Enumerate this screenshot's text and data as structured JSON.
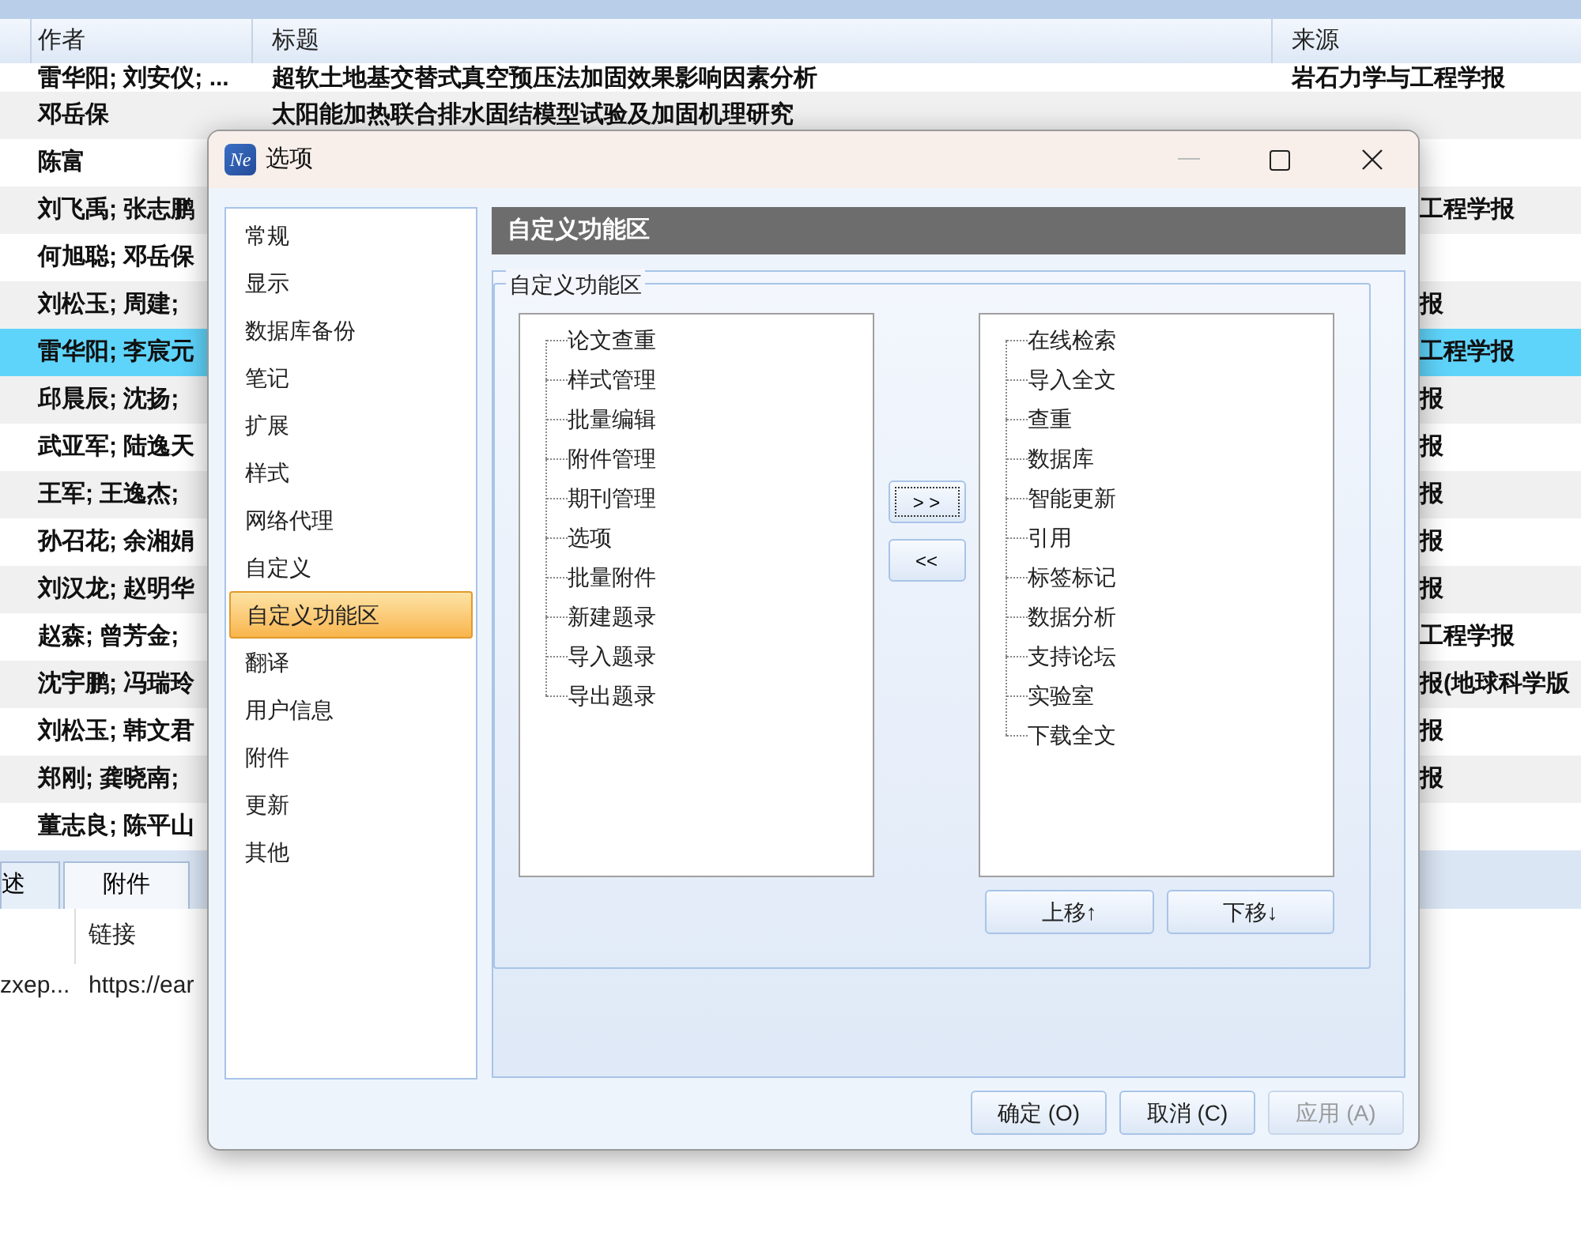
{
  "table": {
    "columns": [
      "作者",
      "标题",
      "来源"
    ],
    "rows": [
      {
        "author": "雷华阳; 刘安仪; ...",
        "title": "超软土地基交替式真空预压法加固效果影响因素分析",
        "source": "岩石力学与工程学报",
        "selected": false
      },
      {
        "author": "邓岳保",
        "title": "太阳能加热联合排水固结模型试验及加固机理研究",
        "selected": false
      },
      {
        "author": "陈富",
        "selected": false
      },
      {
        "author": "刘飞禹; 张志鹏",
        "source": "工程学报",
        "selected": false
      },
      {
        "author": "何旭聪; 邓岳保",
        "selected": false
      },
      {
        "author": "刘松玉; 周建;",
        "source": "报",
        "selected": false
      },
      {
        "author": "雷华阳; 李宸元",
        "source": "工程学报",
        "selected": true
      },
      {
        "author": "邱晨辰; 沈扬;",
        "source": "报",
        "selected": false
      },
      {
        "author": "武亚军; 陆逸天",
        "source": "报",
        "selected": false
      },
      {
        "author": "王军; 王逸杰;",
        "source": "报",
        "selected": false
      },
      {
        "author": "孙召花; 余湘娟",
        "source": "报",
        "selected": false
      },
      {
        "author": "刘汉龙; 赵明华",
        "source": "报",
        "selected": false
      },
      {
        "author": "赵森; 曾芳金;",
        "source": "工程学报",
        "selected": false
      },
      {
        "author": "沈宇鹏; 冯瑞玲",
        "source": "报(地球科学版",
        "selected": false
      },
      {
        "author": "刘松玉; 韩文君",
        "source": "报",
        "selected": false
      },
      {
        "author": "郑刚; 龚晓南;",
        "source": "报",
        "selected": false
      },
      {
        "author": "董志良; 陈平山",
        "selected": false
      }
    ]
  },
  "bottom_panel": {
    "tabs": [
      {
        "label": "述",
        "selected": false
      },
      {
        "label": "附件",
        "selected": true
      }
    ],
    "column": "链接",
    "cells": [
      "zxep...",
      "https://ear"
    ]
  },
  "dialog": {
    "app_icon": "Ne",
    "title": "选项",
    "nav": [
      {
        "label": "常规",
        "selected": false
      },
      {
        "label": "显示",
        "selected": false
      },
      {
        "label": "数据库备份",
        "selected": false
      },
      {
        "label": "笔记",
        "selected": false
      },
      {
        "label": "扩展",
        "selected": false
      },
      {
        "label": "样式",
        "selected": false
      },
      {
        "label": "网络代理",
        "selected": false
      },
      {
        "label": "自定义",
        "selected": false
      },
      {
        "label": "自定义功能区",
        "selected": true
      },
      {
        "label": "翻译",
        "selected": false
      },
      {
        "label": "用户信息",
        "selected": false
      },
      {
        "label": "附件",
        "selected": false
      },
      {
        "label": "更新",
        "selected": false
      },
      {
        "label": "其他",
        "selected": false
      }
    ],
    "header": "自定义功能区",
    "group_title": "自定义功能区",
    "available": [
      "论文查重",
      "样式管理",
      "批量编辑",
      "附件管理",
      "期刊管理",
      "选项",
      "批量附件",
      "新建题录",
      "导入题录",
      "导出题录"
    ],
    "selected_items": [
      "在线检索",
      "导入全文",
      "查重",
      "数据库",
      "智能更新",
      "引用",
      "标签标记",
      "数据分析",
      "支持论坛",
      "实验室",
      "下载全文"
    ],
    "move_buttons": [
      {
        "label": "> >",
        "focused": true
      },
      {
        "label": "<<",
        "focused": false
      }
    ],
    "order_buttons": [
      "上移↑",
      "下移↓"
    ],
    "footer_buttons": [
      {
        "label": "确定 (O)",
        "disabled": false
      },
      {
        "label": "取消 (C)",
        "disabled": false
      },
      {
        "label": "应用 (A)",
        "disabled": true
      }
    ]
  }
}
